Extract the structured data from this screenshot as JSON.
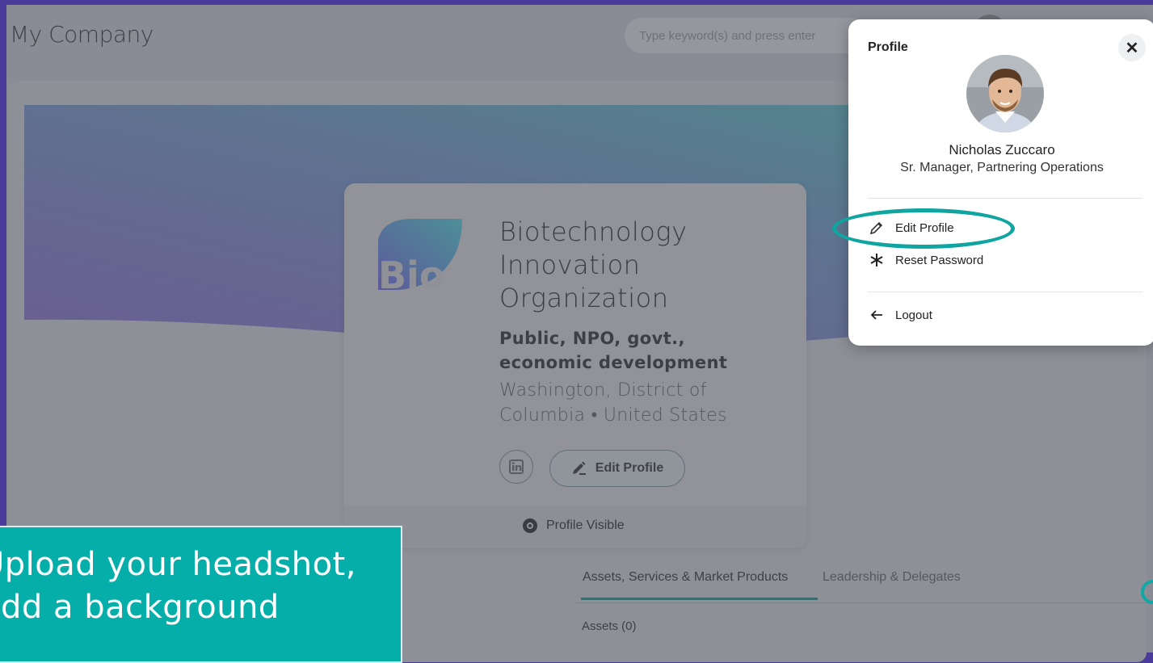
{
  "app": {
    "title": "My Company"
  },
  "search": {
    "placeholder": "Type keyword(s) and press enter"
  },
  "company": {
    "name": "Biotechnology Innovation Organization",
    "type": "Public, NPO, govt., economic development",
    "location": "Washington, District of Columbia • United States",
    "logo_text": "Bio",
    "edit_profile_label": "Edit Profile",
    "visibility_label": "Profile Visible"
  },
  "tabs": {
    "items": [
      {
        "label": "Assets, Services & Market Products",
        "active": true
      },
      {
        "label": "Leadership & Delegates",
        "active": false
      }
    ],
    "assets_count_label": "Assets (0)"
  },
  "popup": {
    "title": "Profile",
    "user_name": "Nicholas Zuccaro",
    "user_role": "Sr. Manager, Partnering Operations",
    "menu": [
      {
        "label": "Edit Profile",
        "icon": "pencil-icon"
      },
      {
        "label": "Reset Password",
        "icon": "asterisk-icon"
      },
      {
        "label": "Logout",
        "icon": "arrow-left-icon"
      }
    ]
  },
  "callout": {
    "text": "Upload your headshot, add a background"
  },
  "colors": {
    "accent": "#05aea9",
    "page_frame": "#4a3a9a"
  }
}
